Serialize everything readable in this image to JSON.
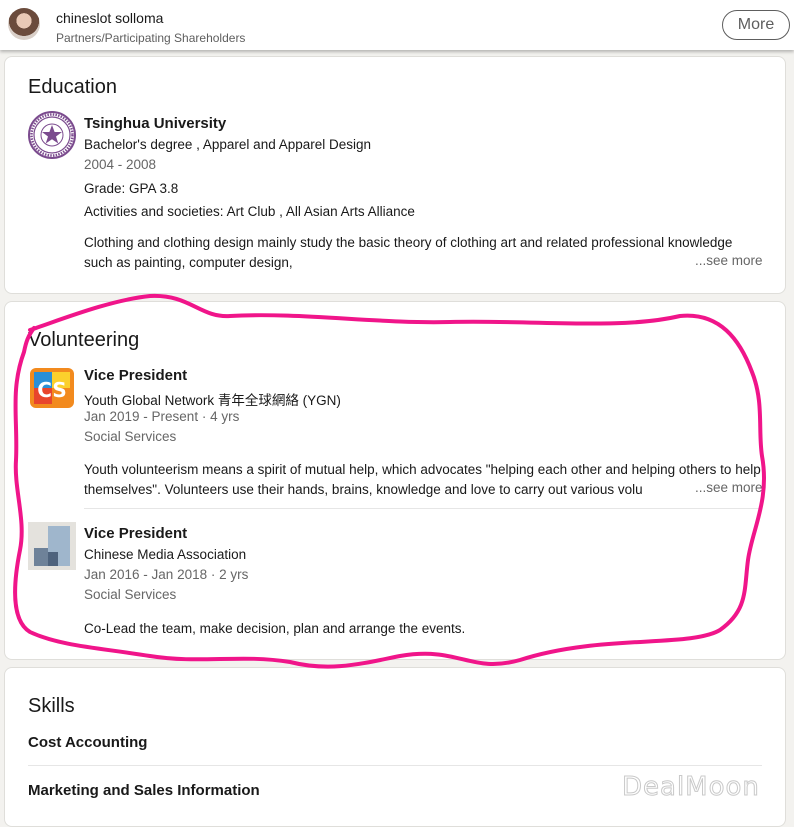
{
  "header": {
    "name": "chineslot solloma",
    "role": "Partners/Participating Shareholders",
    "more_label": "More"
  },
  "education": {
    "title": "Education",
    "entries": [
      {
        "school": "Tsinghua University",
        "degree": "Bachelor's degree , Apparel and Apparel Design",
        "dates": "2004 - 2008",
        "grade": "Grade: GPA 3.8",
        "activities": "Activities and societies: Art Club , All Asian Arts Alliance",
        "description": "Clothing and clothing design mainly study the basic theory of clothing art and related professional knowledge such as painting, computer design,",
        "see_more": "...see more",
        "logo_icon": "university-seal-icon"
      }
    ]
  },
  "volunteering": {
    "title": "Volunteering",
    "entries": [
      {
        "role": "Vice President",
        "org": "Youth Global Network 青年全球網絡 (YGN)",
        "dates": "Jan 2019 - Present · 4 yrs",
        "cause": "Social Services",
        "description": "Youth volunteerism means a spirit of mutual help, which advocates \"helping each other and helping others to help themselves\". Volunteers use their hands, brains, knowledge and love to carry out various volu",
        "see_more": "...see more",
        "logo_icon": "ygn-logo-icon"
      },
      {
        "role": "Vice President",
        "org": "Chinese Media Association",
        "dates": "Jan 2016 - Jan 2018 · 2 yrs",
        "cause": "Social Services",
        "description": "Co-Lead the team, make decision, plan and arrange the events.",
        "logo_icon": "org-placeholder-icon"
      }
    ]
  },
  "skills": {
    "title": "Skills",
    "items": [
      "Cost Accounting",
      "Marketing and Sales Information"
    ]
  },
  "watermark": "DealMoon",
  "colors": {
    "annotation": "#f0158a",
    "ygn_orange": "#f28a1e",
    "ygn_blue": "#2a8fd6",
    "seal_purple": "#7b4b8e"
  }
}
